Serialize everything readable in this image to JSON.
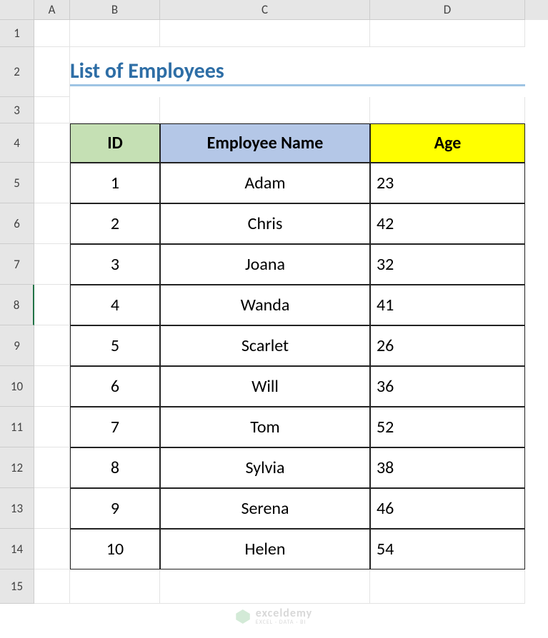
{
  "columns": {
    "A": "A",
    "B": "B",
    "C": "C",
    "D": "D"
  },
  "rows": {
    "1": "1",
    "2": "2",
    "3": "3",
    "4": "4",
    "5": "5",
    "6": "6",
    "7": "7",
    "8": "8",
    "9": "9",
    "10": "10",
    "11": "11",
    "12": "12",
    "13": "13",
    "14": "14",
    "15": "15"
  },
  "title": "List of Employees",
  "headers": {
    "id": "ID",
    "name": "Employee Name",
    "age": "Age"
  },
  "data": [
    {
      "id": "1",
      "name": "Adam",
      "age": "23"
    },
    {
      "id": "2",
      "name": "Chris",
      "age": "42"
    },
    {
      "id": "3",
      "name": "Joana",
      "age": "32"
    },
    {
      "id": "4",
      "name": "Wanda",
      "age": "41"
    },
    {
      "id": "5",
      "name": "Scarlet",
      "age": "26"
    },
    {
      "id": "6",
      "name": "Will",
      "age": "36"
    },
    {
      "id": "7",
      "name": "Tom",
      "age": "52"
    },
    {
      "id": "8",
      "name": "Sylvia",
      "age": "38"
    },
    {
      "id": "9",
      "name": "Serena",
      "age": "46"
    },
    {
      "id": "10",
      "name": "Helen",
      "age": "54"
    }
  ],
  "watermark": {
    "main": "exceldemy",
    "sub": "EXCEL · DATA · BI"
  },
  "selected_row": "8"
}
